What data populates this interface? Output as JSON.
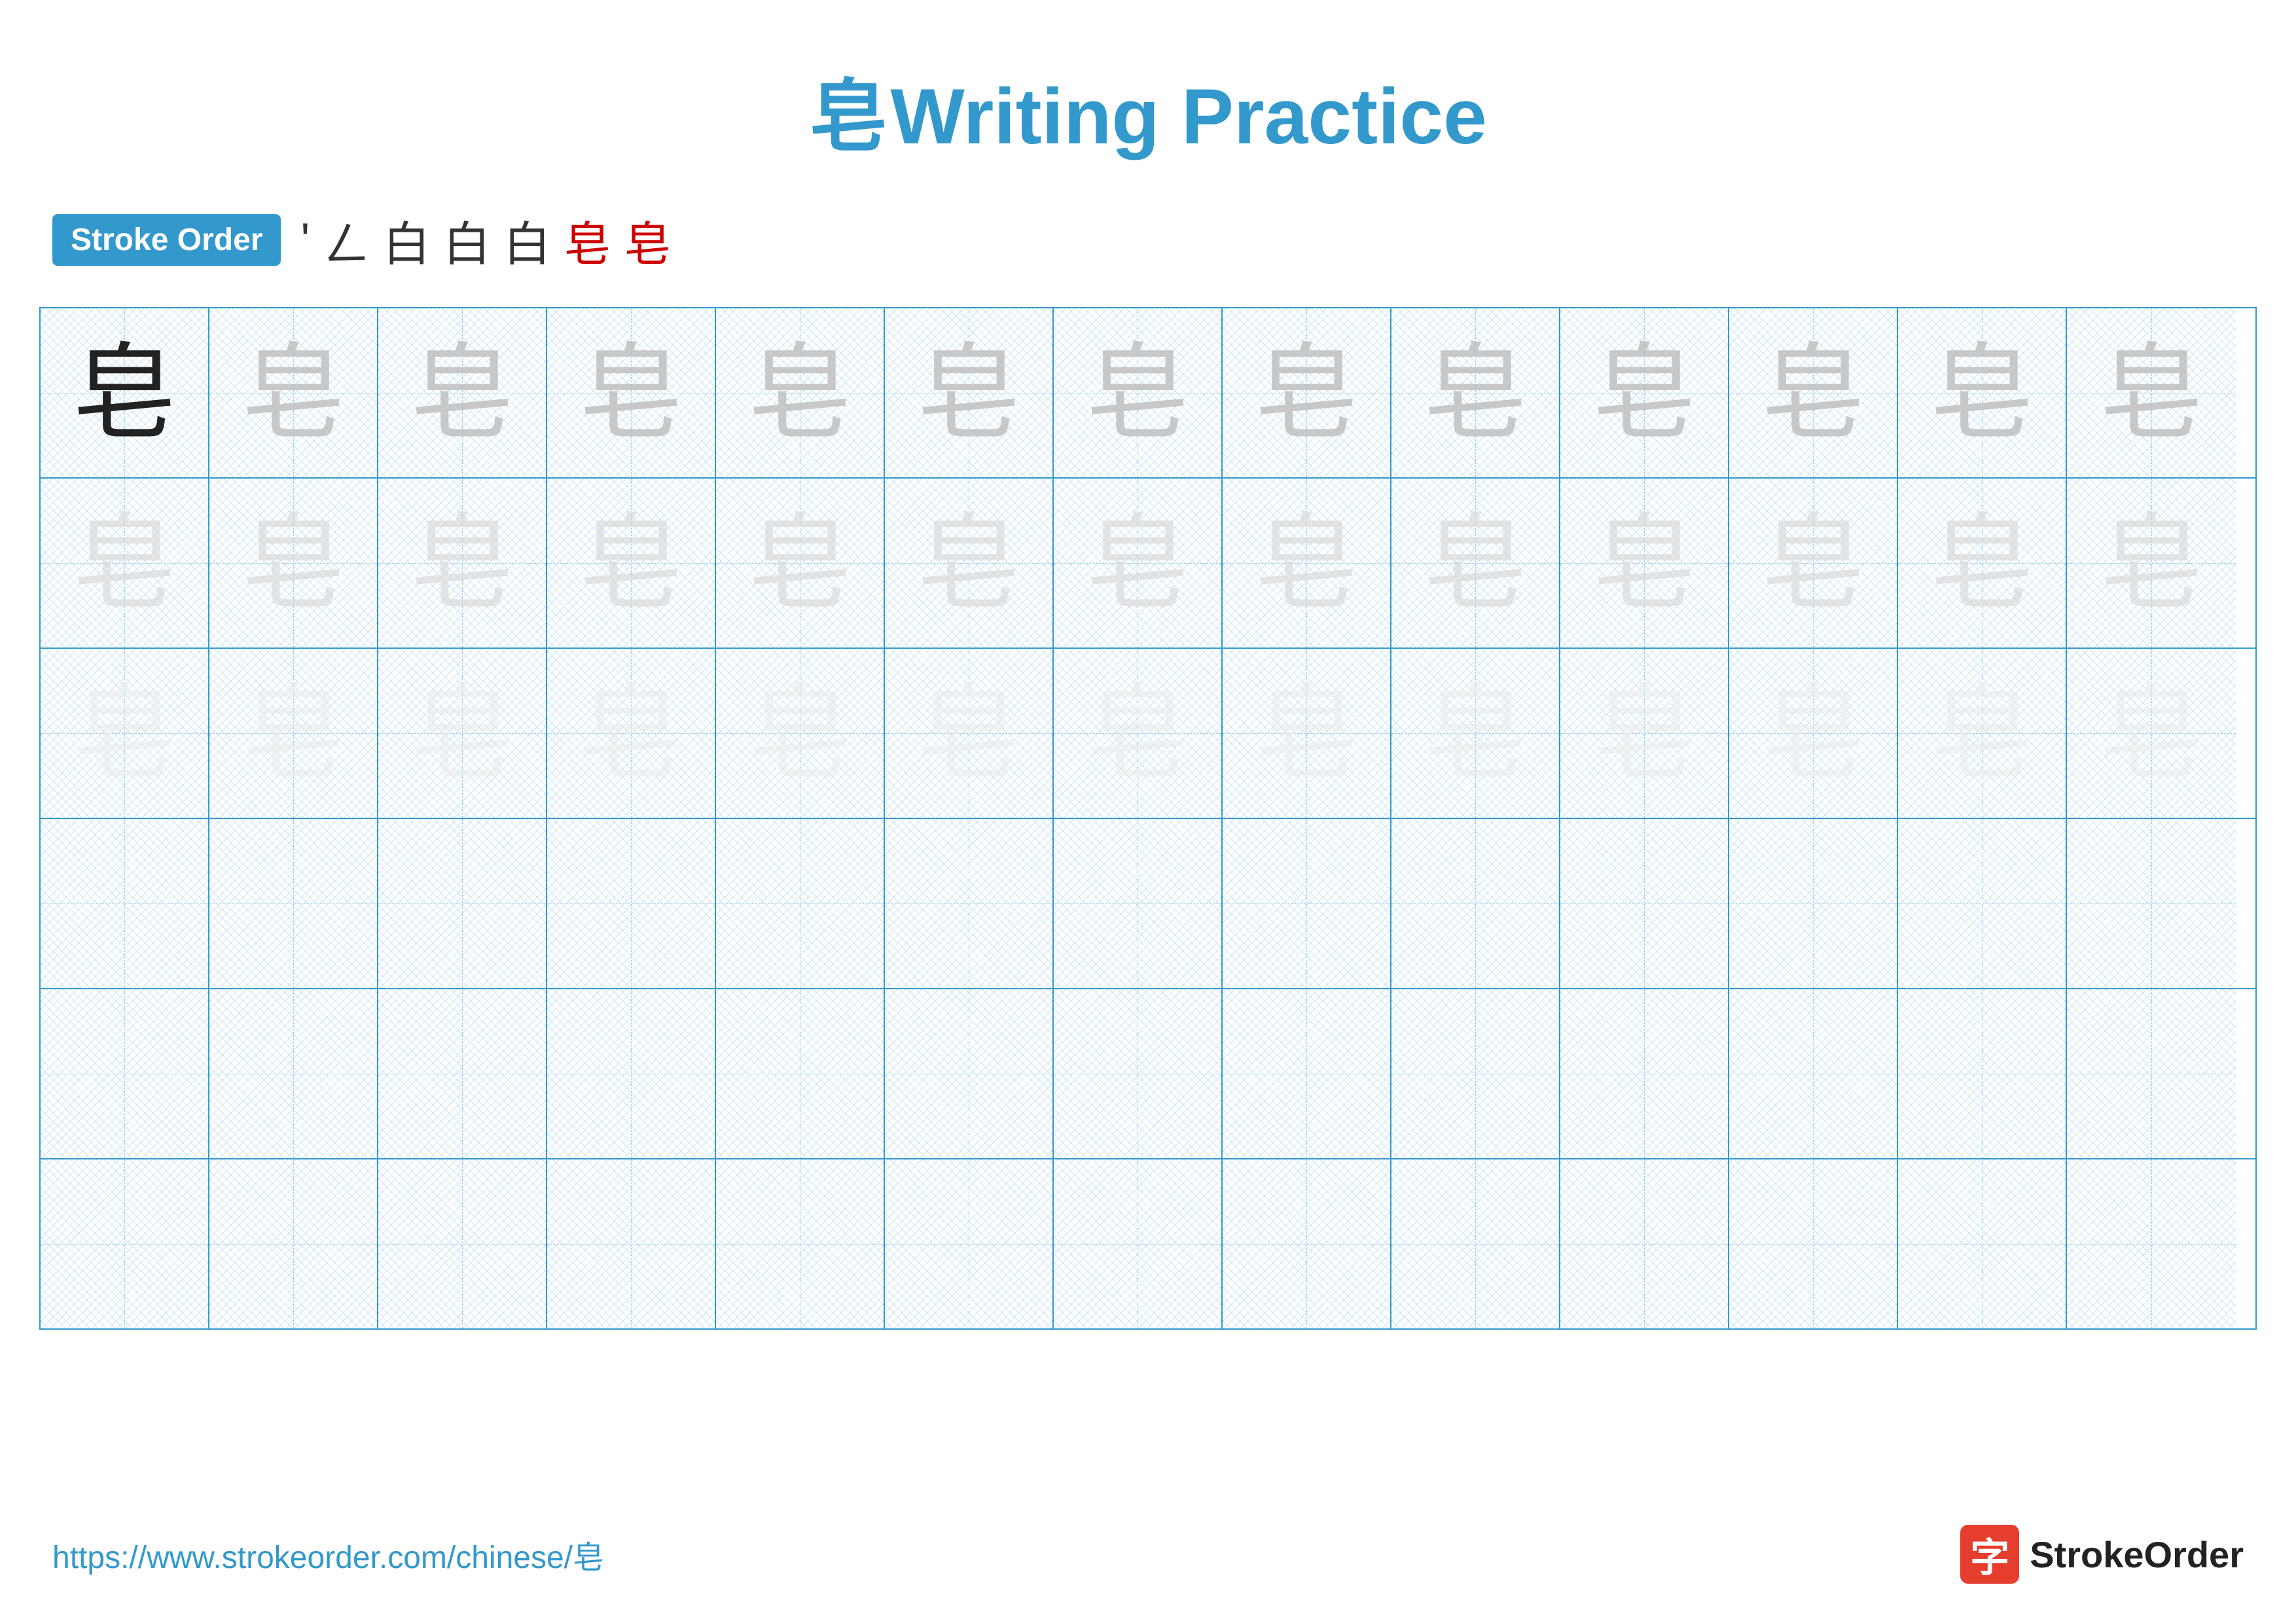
{
  "page": {
    "title": {
      "chinese": "皂",
      "english": " Writing Practice"
    },
    "stroke_order": {
      "badge_label": "Stroke Order",
      "strokes": [
        "'",
        "ㄥ",
        "白",
        "白",
        "白",
        "皂",
        "皂"
      ],
      "red_indices": [
        5,
        6
      ]
    },
    "grid": {
      "rows": 6,
      "cols": 13,
      "character": "皂",
      "row_styles": [
        "dark_then_medium",
        "light",
        "very_light",
        "empty",
        "empty",
        "empty"
      ]
    },
    "footer": {
      "url": "https://www.strokeorder.com/chinese/皂",
      "logo_icon": "字",
      "logo_text": "StrokeOrder"
    },
    "colors": {
      "blue": "#3399cc",
      "red": "#cc0000",
      "dark": "#222222",
      "medium_gray": "#c0c0c0",
      "light_gray": "#d8d8d8",
      "very_light": "#e8e8e8"
    }
  }
}
